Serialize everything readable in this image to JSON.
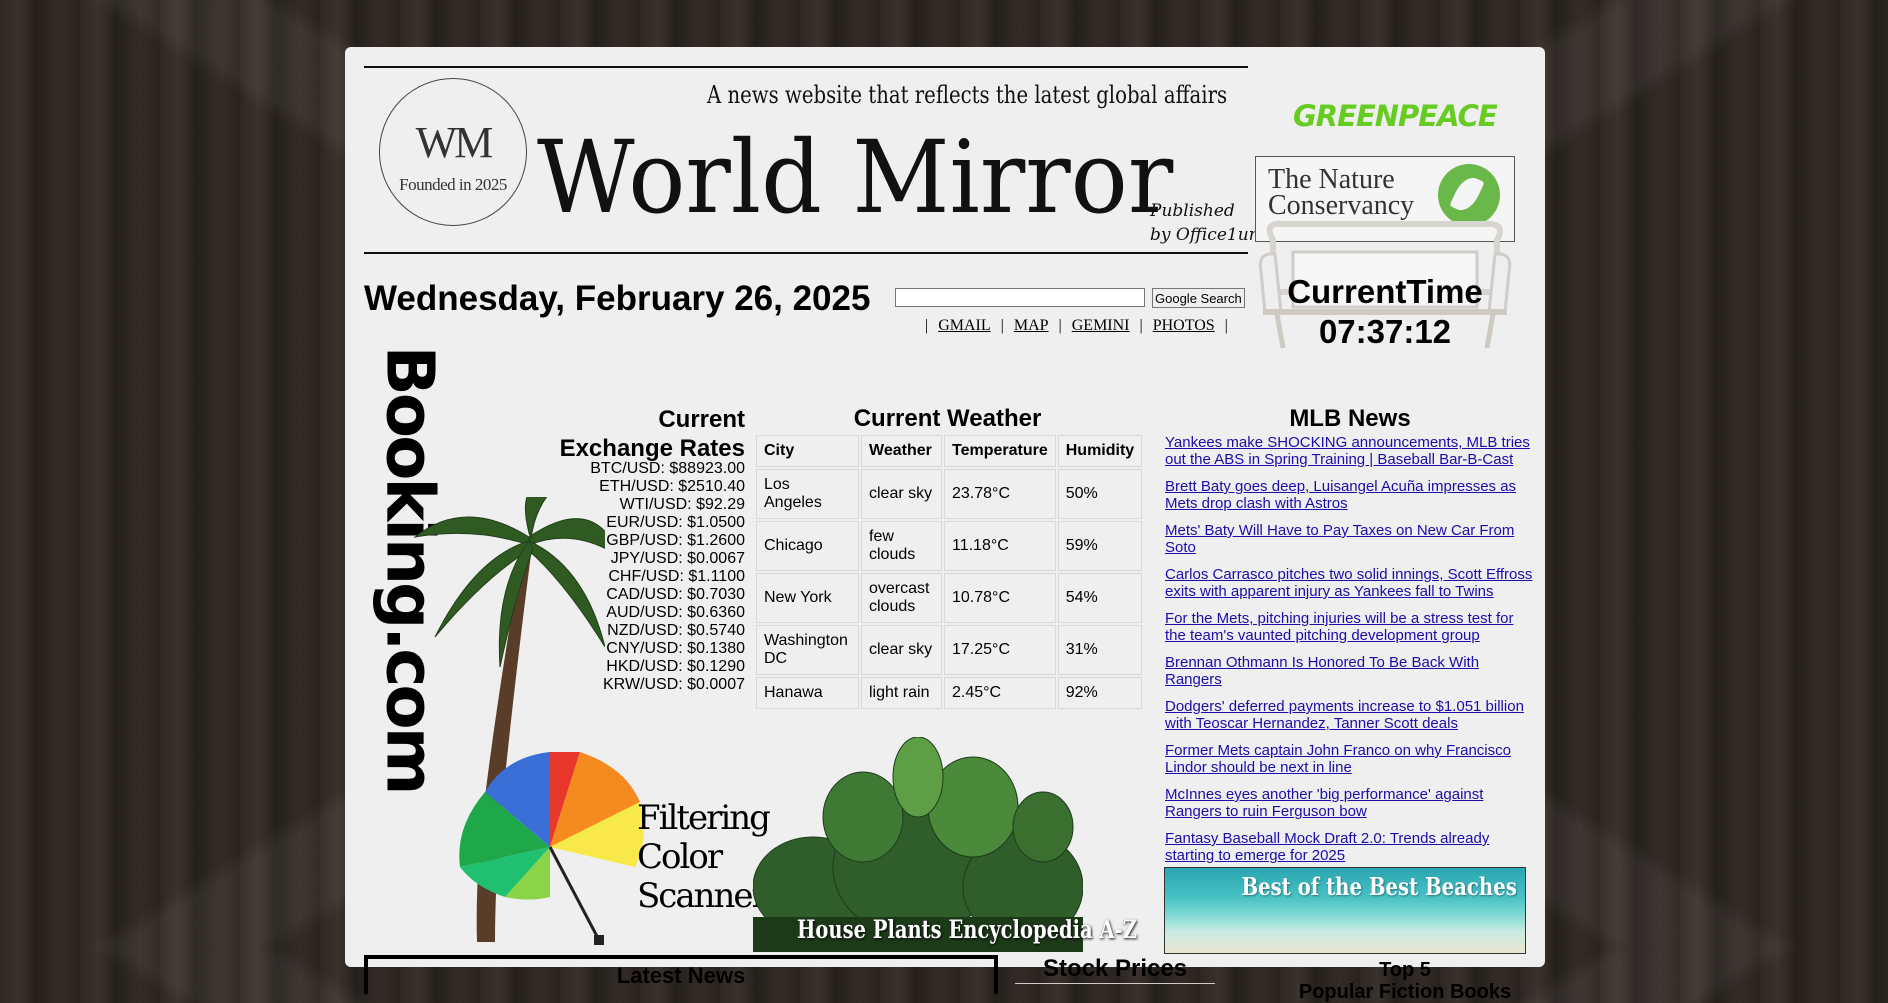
{
  "site": {
    "logo_initials": "WM",
    "logo_sub": "Founded in 2025",
    "tagline": "A news website that reflects the latest global affairs",
    "name": "World Mirror",
    "published_line1": "Published",
    "published_line2": "by Office1un",
    "date": "Wednesday, February 26, 2025"
  },
  "search": {
    "value": "",
    "button_label": "Google Search"
  },
  "toplinks": {
    "sep": "|",
    "items": [
      "GMAIL",
      "MAP",
      "GEMINI",
      "PHOTOS"
    ]
  },
  "sponsors": {
    "greenpeace": "GREENPEACE",
    "nature_line1": "The Nature",
    "nature_line2": "Conservancy",
    "booking": "Booking.com",
    "umbrella_line1": "Filtering",
    "umbrella_line2": "Color",
    "umbrella_line3": "Scanner",
    "plants": "House Plants Encyclopedia A-Z",
    "beach": "Best of the Best Beaches"
  },
  "clock": {
    "label": "CurrentTime",
    "time": "07:37:12"
  },
  "rates": {
    "title_line1": "Current",
    "title_line2": "Exchange Rates",
    "items": [
      "BTC/USD: $88923.00",
      "ETH/USD: $2510.40",
      "WTI/USD: $92.29",
      "EUR/USD: $1.0500",
      "GBP/USD: $1.2600",
      "JPY/USD: $0.0067",
      "CHF/USD: $1.1100",
      "CAD/USD: $0.7030",
      "AUD/USD: $0.6360",
      "NZD/USD: $0.5740",
      "CNY/USD: $0.1380",
      "HKD/USD: $0.1290",
      "KRW/USD: $0.0007"
    ]
  },
  "weather": {
    "title": "Current Weather",
    "headers": [
      "City",
      "Weather",
      "Temperature",
      "Humidity"
    ],
    "rows": [
      [
        "Los Angeles",
        "clear sky",
        "23.78°C",
        "50%"
      ],
      [
        "Chicago",
        "few clouds",
        "11.18°C",
        "59%"
      ],
      [
        "New York",
        "overcast clouds",
        "10.78°C",
        "54%"
      ],
      [
        "Washington DC",
        "clear sky",
        "17.25°C",
        "31%"
      ],
      [
        "Hanawa",
        "light rain",
        "2.45°C",
        "92%"
      ]
    ]
  },
  "mlb": {
    "title": "MLB News",
    "items": [
      "Yankees make SHOCKING announcements, MLB tries out the ABS in Spring Training | Baseball Bar-B-Cast",
      "Brett Baty goes deep, Luisangel Acuña impresses as Mets drop clash with Astros",
      "Mets' Baty Will Have to Pay Taxes on New Car From Soto",
      "Carlos Carrasco pitches two solid innings, Scott Effross exits with apparent injury as Yankees fall to Twins",
      "For the Mets, pitching injuries will be a stress test for the team's vaunted pitching development group",
      "Brennan Othmann Is Honored To Be Back With Rangers",
      "Dodgers' deferred payments increase to $1.051 billion with Teoscar Hernandez, Tanner Scott deals",
      "Former Mets captain John Franco on why Francisco Lindor should be next in line",
      "McInnes eyes another 'big performance' against Rangers to ruin Ferguson bow",
      "Fantasy Baseball Mock Draft 2.0: Trends already starting to emerge for 2025"
    ]
  },
  "sections": {
    "latest": "Latest News",
    "stocks": "Stock Prices",
    "top5_line1": "Top 5",
    "top5_line2": "Popular Fiction Books"
  }
}
